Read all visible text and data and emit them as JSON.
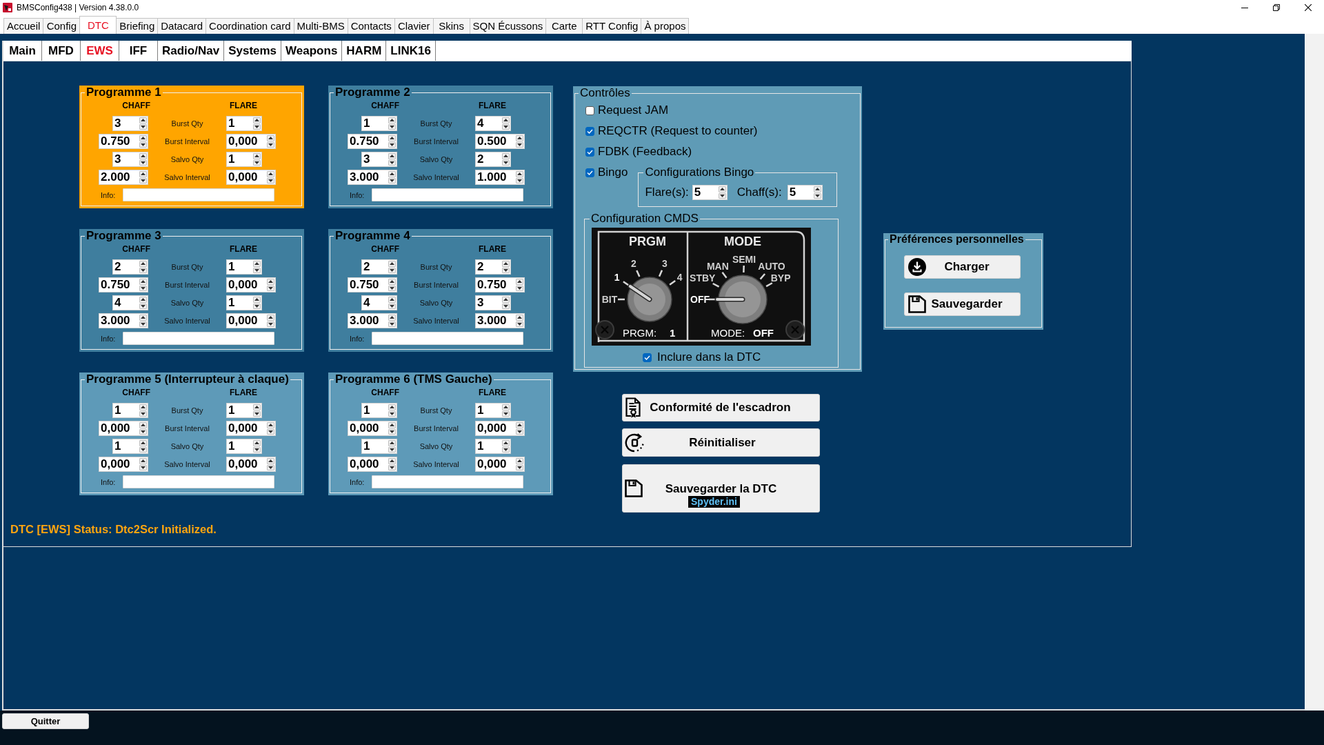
{
  "window": {
    "title": "BMSConfig438 | Version 4.38.0.0"
  },
  "tabs": [
    {
      "label": "Accueil",
      "selected": false
    },
    {
      "label": "Config",
      "selected": false
    },
    {
      "label": "DTC",
      "selected": true
    },
    {
      "label": "Briefing",
      "selected": false
    },
    {
      "label": "Datacard",
      "selected": false
    },
    {
      "label": "Coordination card",
      "selected": false
    },
    {
      "label": "Multi-BMS",
      "selected": false
    },
    {
      "label": "Contacts",
      "selected": false
    },
    {
      "label": "Clavier",
      "selected": false
    },
    {
      "label": "Skins",
      "selected": false
    },
    {
      "label": "SQN Écussons",
      "selected": false
    },
    {
      "label": "Carte",
      "selected": false
    },
    {
      "label": "RTT Config",
      "selected": false
    },
    {
      "label": "À propos",
      "selected": false
    }
  ],
  "subtabs": [
    {
      "label": "Main",
      "selected": false
    },
    {
      "label": "MFD",
      "selected": false
    },
    {
      "label": "EWS",
      "selected": true
    },
    {
      "label": "IFF",
      "selected": false
    },
    {
      "label": "Radio/Nav",
      "selected": false
    },
    {
      "label": "Systems",
      "selected": false
    },
    {
      "label": "Weapons",
      "selected": false
    },
    {
      "label": "HARM",
      "selected": false
    },
    {
      "label": "LINK16",
      "selected": false
    }
  ],
  "programmes": [
    {
      "title": "Programme 1",
      "selected": true,
      "columns": [
        "CHAFF",
        "FLARE"
      ],
      "rows": [
        {
          "label": "Burst Qty",
          "chaff": "3",
          "flare": "1"
        },
        {
          "label": "Burst Interval",
          "chaff": "0.750",
          "flare": "0,000"
        },
        {
          "label": "Salvo Qty",
          "chaff": "3",
          "flare": "1"
        },
        {
          "label": "Salvo Interval",
          "chaff": "2.000",
          "flare": "0,000"
        }
      ],
      "info_label": "Info:"
    },
    {
      "title": "Programme 2",
      "selected": false,
      "color": "#3f7e9e",
      "columns": [
        "CHAFF",
        "FLARE"
      ],
      "rows": [
        {
          "label": "Burst Qty",
          "chaff": "1",
          "flare": "4"
        },
        {
          "label": "Burst Interval",
          "chaff": "0.750",
          "flare": "0.500"
        },
        {
          "label": "Salvo Qty",
          "chaff": "3",
          "flare": "2"
        },
        {
          "label": "Salvo Interval",
          "chaff": "3.000",
          "flare": "1.000"
        }
      ],
      "info_label": "Info:"
    },
    {
      "title": "Programme 3",
      "selected": false,
      "color": "#3f7e9e",
      "columns": [
        "CHAFF",
        "FLARE"
      ],
      "rows": [
        {
          "label": "Burst Qty",
          "chaff": "2",
          "flare": "1"
        },
        {
          "label": "Burst Interval",
          "chaff": "0.750",
          "flare": "0,000"
        },
        {
          "label": "Salvo Qty",
          "chaff": "4",
          "flare": "1"
        },
        {
          "label": "Salvo Interval",
          "chaff": "3.000",
          "flare": "0,000"
        }
      ],
      "info_label": "Info:"
    },
    {
      "title": "Programme 4",
      "selected": false,
      "color": "#3f7e9e",
      "columns": [
        "CHAFF",
        "FLARE"
      ],
      "rows": [
        {
          "label": "Burst Qty",
          "chaff": "2",
          "flare": "2"
        },
        {
          "label": "Burst Interval",
          "chaff": "0.750",
          "flare": "0.750"
        },
        {
          "label": "Salvo Qty",
          "chaff": "4",
          "flare": "3"
        },
        {
          "label": "Salvo Interval",
          "chaff": "3.000",
          "flare": "3.000"
        }
      ],
      "info_label": "Info:"
    },
    {
      "title": "Programme 5 (Interrupteur à claque)",
      "selected": false,
      "color": "#5e9ab8",
      "columns": [
        "CHAFF",
        "FLARE"
      ],
      "rows": [
        {
          "label": "Burst Qty",
          "chaff": "1",
          "flare": "1"
        },
        {
          "label": "Burst Interval",
          "chaff": "0,000",
          "flare": "0,000"
        },
        {
          "label": "Salvo Qty",
          "chaff": "1",
          "flare": "1"
        },
        {
          "label": "Salvo Interval",
          "chaff": "0,000",
          "flare": "0,000"
        }
      ],
      "info_label": "Info:"
    },
    {
      "title": "Programme 6 (TMS Gauche)",
      "selected": false,
      "color": "#5e9ab8",
      "columns": [
        "CHAFF",
        "FLARE"
      ],
      "rows": [
        {
          "label": "Burst Qty",
          "chaff": "1",
          "flare": "1"
        },
        {
          "label": "Burst Interval",
          "chaff": "0,000",
          "flare": "0,000"
        },
        {
          "label": "Salvo Qty",
          "chaff": "1",
          "flare": "1"
        },
        {
          "label": "Salvo Interval",
          "chaff": "0,000",
          "flare": "0,000"
        }
      ],
      "info_label": "Info:"
    }
  ],
  "controls": {
    "title": "Contrôles",
    "options": [
      {
        "label": "Request JAM",
        "checked": false
      },
      {
        "label": "REQCTR (Request to counter)",
        "checked": true
      },
      {
        "label": "FDBK (Feedback)",
        "checked": true
      },
      {
        "label": "Bingo",
        "checked": true,
        "settings": {
          "title": "Configurations Bingo",
          "fields": [
            {
              "label": "Flare(s):",
              "value": "5"
            },
            {
              "label": "Chaff(s):",
              "value": "5"
            }
          ]
        }
      }
    ],
    "cmds": {
      "title": "Configuration CMDS",
      "dials": [
        {
          "title": "PRGM",
          "positions": [
            {
              "label": "BIT",
              "selected": false
            },
            {
              "label": "1",
              "selected": true
            },
            {
              "label": "2",
              "selected": false
            },
            {
              "label": "3",
              "selected": false
            },
            {
              "label": "4",
              "selected": false
            }
          ],
          "readout_label": "PRGM:",
          "readout_value": "1"
        },
        {
          "title": "MODE",
          "positions": [
            {
              "label": "OFF",
              "selected": true
            },
            {
              "label": "STBY",
              "selected": false
            },
            {
              "label": "MAN",
              "selected": false
            },
            {
              "label": "SEMI",
              "selected": false
            },
            {
              "label": "AUTO",
              "selected": false
            },
            {
              "label": "BYP",
              "selected": false
            }
          ],
          "readout_label": "MODE:",
          "readout_value": "OFF"
        }
      ]
    },
    "include": {
      "label": "Inclure dans la DTC",
      "checked": true
    }
  },
  "actions": [
    {
      "kind": "compliance",
      "label": "Conformité de l'escadron"
    },
    {
      "kind": "reset",
      "label": "Réinitialiser"
    },
    {
      "kind": "save",
      "label": "Sauvegarder la DTC",
      "file": "Spyder.ini"
    }
  ],
  "preferences": {
    "title": "Préférences personnelles",
    "buttons": [
      {
        "kind": "load",
        "label": "Charger"
      },
      {
        "kind": "save",
        "label": "Sauvegarder"
      }
    ]
  },
  "status": {
    "message": "DTC [EWS] Status: Dtc2Scr Initialized."
  },
  "footer": {
    "quit_button": "Quitter"
  }
}
